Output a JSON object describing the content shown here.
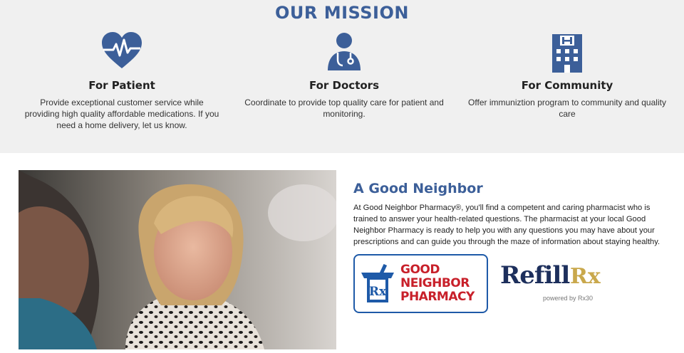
{
  "mission": {
    "title": "OUR MISSION",
    "columns": [
      {
        "icon": "heartbeat-icon",
        "title": "For Patient",
        "description": "Provide exceptional customer service while providing high quality affordable medications. If you need a home delivery, let us know."
      },
      {
        "icon": "doctor-icon",
        "title": "For Doctors",
        "description": "Coordinate to provide top quality care for patient and monitoring."
      },
      {
        "icon": "hospital-icon",
        "title": "For Community",
        "description": "Offer immuniztion program to community and quality care"
      }
    ],
    "accent_color": "#3c5f99"
  },
  "neighbor": {
    "title": "A Good Neighbor",
    "body": "At Good Neighbor Pharmacy®, you'll find a competent and caring pharmacist who is trained to answer your health-related questions. The pharmacist at your local Good Neighbor Pharmacy is ready to help you with any questions you may have about your prescriptions and can guide you through the maze of information about staying healthy."
  },
  "logos": {
    "gnp": {
      "mark": "Rx",
      "line1": "GOOD",
      "line2": "NEIGHBOR",
      "line3": "PHARMACY"
    },
    "refill": {
      "word": "Refill",
      "rx": "Rx",
      "powered": "powered by Rx30"
    }
  }
}
